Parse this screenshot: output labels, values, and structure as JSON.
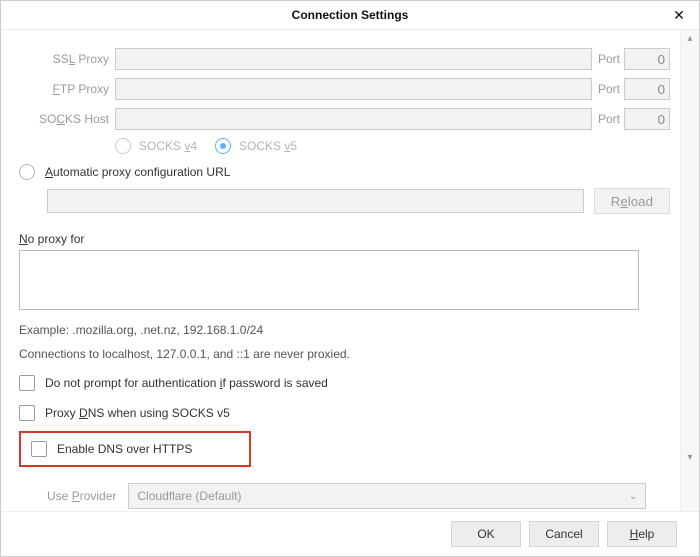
{
  "dialog": {
    "title": "Connection Settings"
  },
  "proxy": {
    "ssl_label_html": "SS<span class='underline-key'>L</span> Proxy",
    "ftp_label_html": "<span class='underline-key'>F</span>TP Proxy",
    "socks_label_html": "SO<span class='underline-key'>C</span>KS Host",
    "port_label": "Port",
    "ssl_port": "0",
    "ftp_port": "0",
    "socks_port": "0",
    "socks_v4_label_html": "SOCKS <span class='underline-key'>v</span>4",
    "socks_v5_label_html": "SOCKS <span class='underline-key'>v</span>5"
  },
  "auto": {
    "label_html": "<span class='underline-key'>A</span>utomatic proxy configuration URL",
    "reload_label_html": "R<span class='underline-key'>e</span>load"
  },
  "noproxy": {
    "label_html": "<span class='underline-key'>N</span>o proxy for",
    "example": "Example: .mozilla.org, .net.nz, 192.168.1.0/24",
    "never_proxied": "Connections to localhost, 127.0.0.1, and ::1 are never proxied."
  },
  "checks": {
    "no_prompt_html": "Do not prompt for authentication <span class='underline-key'>i</span>f password is saved",
    "proxy_dns_html": "Proxy <span class='underline-key'>D</span>NS when using SOCKS v5",
    "enable_doh": "Enable DNS over HTTPS"
  },
  "provider": {
    "label_html": "Use <span class='underline-key'>P</span>rovider",
    "value": "Cloudflare (Default)"
  },
  "buttons": {
    "ok": "OK",
    "cancel": "Cancel",
    "help_html": "<span class='underline-key'>H</span>elp"
  }
}
